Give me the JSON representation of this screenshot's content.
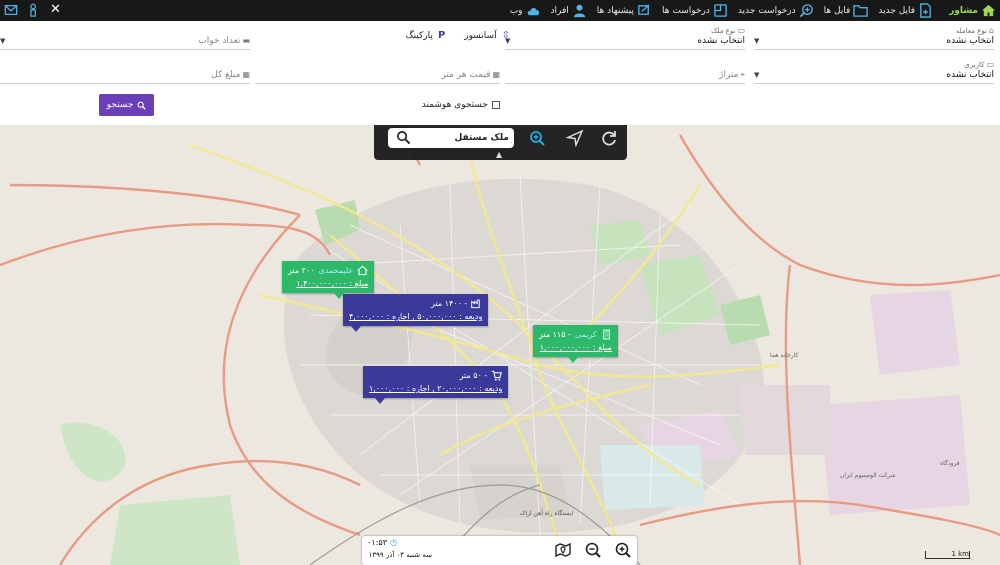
{
  "topbar": {
    "brand": "مشاور",
    "items": [
      {
        "label": "فایل جدید",
        "icon": "file-add-icon"
      },
      {
        "label": "فایل ها",
        "icon": "folder-icon"
      },
      {
        "label": "درخواست جدید",
        "icon": "search-plus-icon"
      },
      {
        "label": "درخواست ها",
        "icon": "request-icon"
      },
      {
        "label": "پیشنهاد ها",
        "icon": "offer-icon"
      },
      {
        "label": "افراد",
        "icon": "person-icon"
      },
      {
        "label": "وب",
        "icon": "cloud-icon"
      }
    ],
    "left_close": "✕"
  },
  "filters": {
    "deal_type": {
      "caption": "نوع معامله",
      "value": "انتخاب نشده"
    },
    "property_type": {
      "caption": "نوع ملک",
      "value": "انتخاب نشده"
    },
    "features": {
      "elevator": "آسانسور",
      "parking": "پارکینگ",
      "parking_badge": "P"
    },
    "bedrooms": {
      "placeholder": "تعداد خواب"
    },
    "usage": {
      "caption": "کاربری",
      "value": "انتخاب نشده"
    },
    "area": {
      "placeholder": "متراژ"
    },
    "price_per_meter": {
      "placeholder": "قیمت هر متر"
    },
    "total_price": {
      "placeholder": "مبلغ کل"
    },
    "smart_search": "جستجوی هوشمند",
    "search_button": "جستجو"
  },
  "map": {
    "search_text": "ملک مستقل",
    "pins": [
      {
        "title": "۲۰۰ متر",
        "name": "علیمحمدی",
        "line2": "مبلغ : ۱,۴۰۰,۰۰۰,۰۰۰",
        "color": "green"
      },
      {
        "title": "- ۱۴۰۰ متر",
        "name": "",
        "line2": "ودیعه : ۵۰,۰۰۰,۰۰۰ , اجاره : ۴,۰۰۰,۰۰۰",
        "color": "blue"
      },
      {
        "title": "- ۱۱۵ متر",
        "name": "کریمی",
        "line2": "مبلغ : ۱,۰۰۰,۰۰۰,۰۰۰",
        "color": "green"
      },
      {
        "title": "- ۵۰ متر",
        "name": "",
        "line2": "ودیعه : ۲۰,۰۰۰,۰۰۰ , اجاره : ۱,۰۰۰,۰۰۰",
        "color": "blue"
      }
    ],
    "clock": "۰۱:۵۳",
    "date": "سه شنبه ۰۴ آذر ۱۳۹۹",
    "scale": "1 km",
    "labels": [
      "کارخانه هما",
      "شرکت الومینیوم ایران",
      "فرودگاه",
      "ایستگاه راه آهن اراک"
    ]
  }
}
